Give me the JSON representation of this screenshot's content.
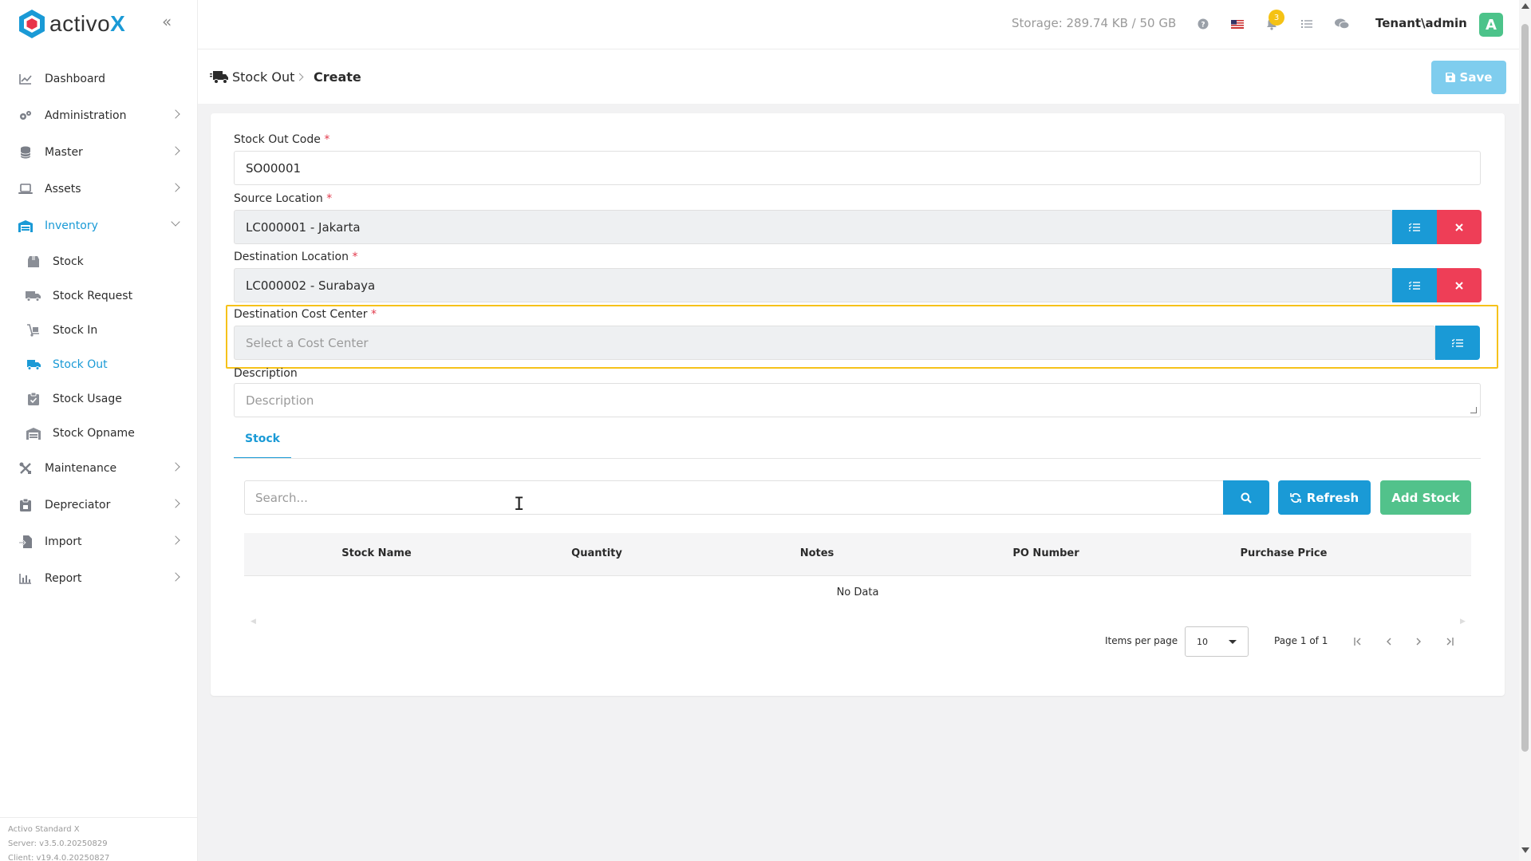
{
  "app": {
    "logo_text_plain": "activo",
    "logo_text_accent": "X",
    "brand_color": "#1a9ad6"
  },
  "sidebar": {
    "items": [
      {
        "label": "Dashboard",
        "icon": "chart-line-icon"
      },
      {
        "label": "Administration",
        "icon": "gears-icon"
      },
      {
        "label": "Master",
        "icon": "database-icon"
      },
      {
        "label": "Assets",
        "icon": "laptop-icon"
      },
      {
        "label": "Inventory",
        "icon": "warehouse-icon",
        "expanded": true
      },
      {
        "label": "Maintenance",
        "icon": "tools-icon"
      },
      {
        "label": "Depreciator",
        "icon": "clipboard-icon"
      },
      {
        "label": "Import",
        "icon": "file-import-icon"
      },
      {
        "label": "Report",
        "icon": "chart-bar-icon"
      }
    ],
    "inventory_sub": [
      {
        "label": "Stock",
        "icon": "box-icon"
      },
      {
        "label": "Stock Request",
        "icon": "truck-icon"
      },
      {
        "label": "Stock In",
        "icon": "dolly-icon"
      },
      {
        "label": "Stock Out",
        "icon": "truck-fast-icon",
        "active": true
      },
      {
        "label": "Stock Usage",
        "icon": "clipboard-check-icon"
      },
      {
        "label": "Stock Opname",
        "icon": "warehouse-icon"
      }
    ],
    "footer": {
      "product": "Activo Standard X",
      "server": "Server: v3.5.0.20250829",
      "client": "Client: v19.4.0.20250827"
    }
  },
  "topbar": {
    "storage": "Storage: 289.74 KB / 50 GB",
    "notification_count": "3",
    "user": "Tenant\\admin",
    "avatar_letter": "A"
  },
  "header": {
    "breadcrumb_parent": "Stock Out",
    "breadcrumb_current": "Create",
    "save_label": "Save"
  },
  "form": {
    "code_label": "Stock Out Code",
    "code_value": "SO00001",
    "source_label": "Source Location",
    "source_value": "LC000001 - Jakarta",
    "dest_label": "Destination Location",
    "dest_value": "LC000002 - Surabaya",
    "cost_center_label": "Destination Cost Center",
    "cost_center_placeholder": "Select a Cost Center",
    "description_label": "Description",
    "description_placeholder": "Description",
    "required_mark": "*"
  },
  "stock_tab": {
    "tab_label": "Stock",
    "search_placeholder": "Search...",
    "refresh_label": "Refresh",
    "add_label": "Add Stock",
    "columns": [
      "Stock Name",
      "Quantity",
      "Notes",
      "PO Number",
      "Purchase Price"
    ],
    "empty_text": "No Data",
    "items_per_page_label": "Items per page",
    "items_per_page_value": "10",
    "page_text": "Page 1 of 1"
  },
  "colors": {
    "primary": "#1a9ad6",
    "danger": "#ee3e57",
    "success": "#52c28b",
    "highlight": "#f6c21a",
    "save_disabled": "#7fcdee"
  }
}
